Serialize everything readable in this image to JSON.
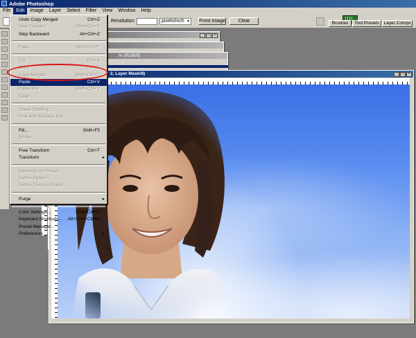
{
  "app": {
    "title": "Adobe Photoshop"
  },
  "menubar": [
    "File",
    "Edit",
    "Image",
    "Layer",
    "Select",
    "Filter",
    "View",
    "Window",
    "Help"
  ],
  "options": {
    "resolution_label": "Resolution:",
    "units": "pixels/inch",
    "front_image": "Front Image",
    "clear": "Clear"
  },
  "palette_tabs": [
    "Brushes",
    "Tool Presets",
    "Layer Comps"
  ],
  "doc_windows": {
    "back_title": "% (RGB/8)",
    "front_title": "2, Layer Mask/8)"
  },
  "edit_menu": [
    {
      "label": "Undo Copy Merged",
      "shortcut": "Ctrl+Z",
      "enabled": true
    },
    {
      "label": "Step Forward",
      "shortcut": "Shift+Ctrl+Z",
      "enabled": false
    },
    {
      "label": "Step Backward",
      "shortcut": "Alt+Ctrl+Z",
      "enabled": true
    },
    {
      "sep": true
    },
    {
      "label": "Fade...",
      "shortcut": "Shift+Ctrl+F",
      "enabled": false
    },
    {
      "sep": true
    },
    {
      "label": "Cut",
      "shortcut": "Ctrl+X",
      "enabled": false
    },
    {
      "label": "Copy",
      "shortcut": "Ctrl+C",
      "enabled": false
    },
    {
      "label": "Copy Merged",
      "shortcut": "Shift+Ctrl+C",
      "enabled": false
    },
    {
      "label": "Paste",
      "shortcut": "Ctrl+V",
      "enabled": true,
      "highlight": true
    },
    {
      "label": "Paste Into",
      "shortcut": "Shift+Ctrl+V",
      "enabled": false
    },
    {
      "label": "Clear",
      "shortcut": "",
      "enabled": false
    },
    {
      "sep": true
    },
    {
      "label": "Check Spelling...",
      "shortcut": "",
      "enabled": false
    },
    {
      "label": "Find and Replace Text...",
      "shortcut": "",
      "enabled": false
    },
    {
      "sep": true
    },
    {
      "label": "Fill...",
      "shortcut": "Shift+F5",
      "enabled": true
    },
    {
      "label": "Stroke...",
      "shortcut": "",
      "enabled": false
    },
    {
      "sep": true
    },
    {
      "label": "Free Transform",
      "shortcut": "Ctrl+T",
      "enabled": true
    },
    {
      "label": "Transform",
      "shortcut": "",
      "enabled": true,
      "submenu": true
    },
    {
      "sep": true
    },
    {
      "label": "Define Brush Preset...",
      "shortcut": "",
      "enabled": false
    },
    {
      "label": "Define Pattern...",
      "shortcut": "",
      "enabled": false
    },
    {
      "label": "Define Custom Shape...",
      "shortcut": "",
      "enabled": false
    },
    {
      "sep": true
    },
    {
      "label": "Purge",
      "shortcut": "",
      "enabled": true,
      "submenu": true
    },
    {
      "sep": true
    },
    {
      "label": "Color Settings...",
      "shortcut": "Shift+Ctrl+K",
      "enabled": true
    },
    {
      "label": "Keyboard Shortcuts...",
      "shortcut": "Alt+Shift+Ctrl+K",
      "enabled": true
    },
    {
      "label": "Preset Manager...",
      "shortcut": "",
      "enabled": true
    },
    {
      "label": "Preferences",
      "shortcut": "",
      "enabled": true,
      "submenu": true
    }
  ],
  "colors": {
    "highlight": "#0a246a",
    "annotation": "#dd1111",
    "sky": "#5a8ef0"
  }
}
